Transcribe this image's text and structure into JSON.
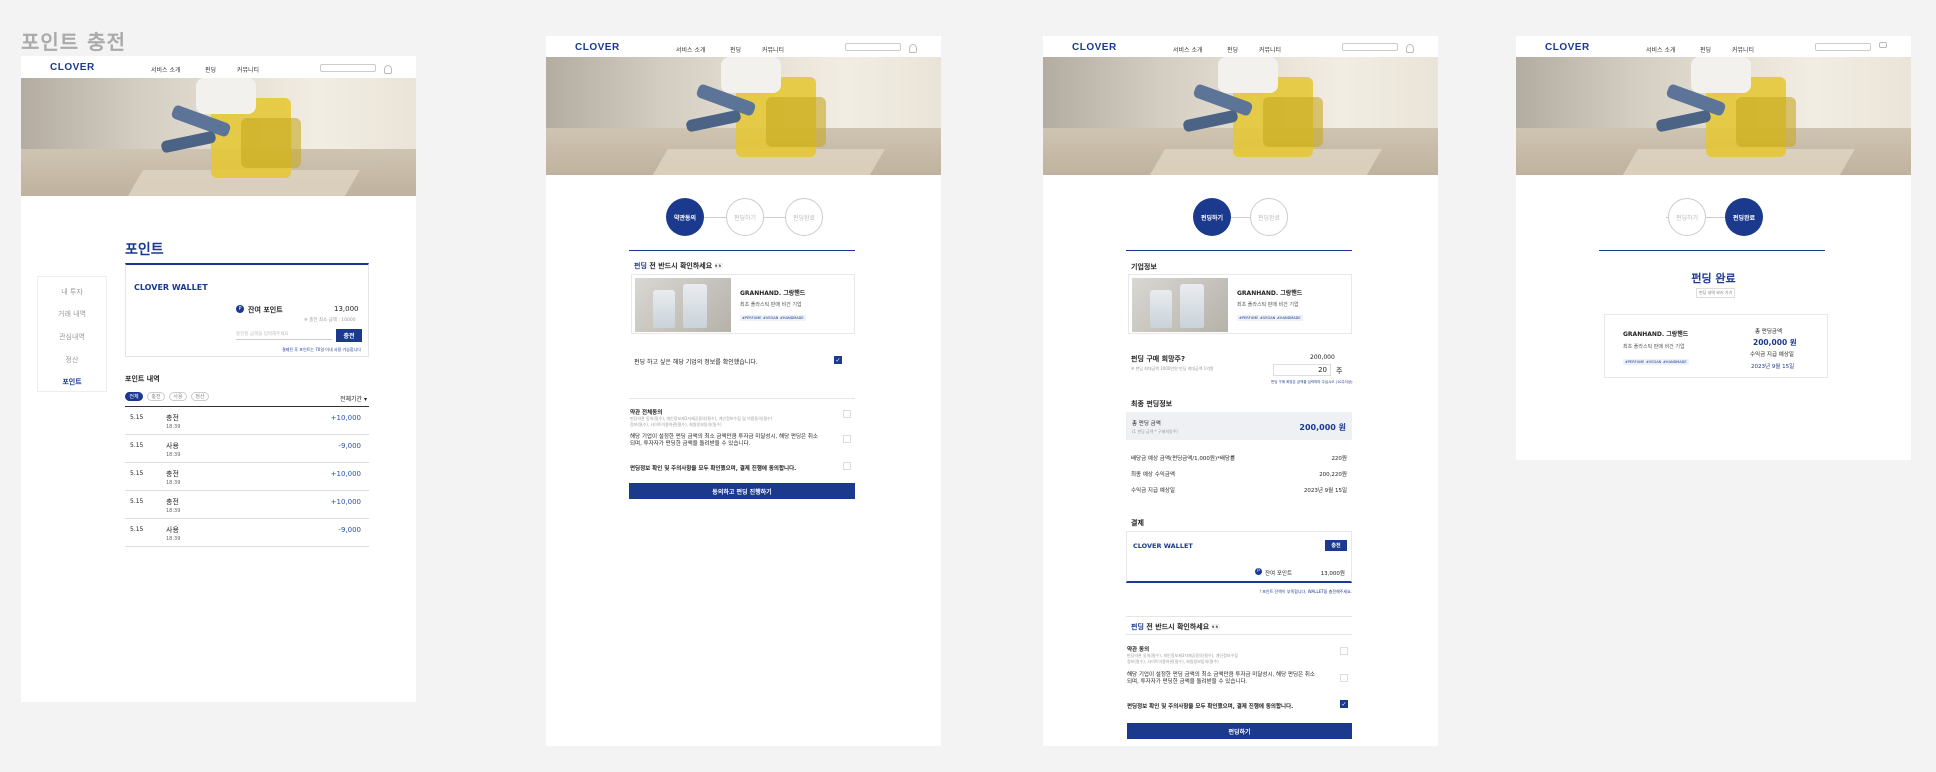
{
  "page_title": "포인트 충전",
  "nav": {
    "logo": "CLOVER",
    "links": [
      "서비스 소개",
      "펀딩",
      "커뮤니티"
    ]
  },
  "board1": {
    "sidebar": [
      "내 투자",
      "거래 내역",
      "관심내역",
      "정산",
      "포인트"
    ],
    "heading": "포인트",
    "wallet_title": "CLOVER WALLET",
    "balance_label": "잔여 포인트",
    "balance_value": "13,000",
    "min_charge_note": "※ 충전 최소 금액 : 10000",
    "charge_input_placeholder": "충전할 금액을 입력해주세요",
    "charge_button": "충전",
    "charge_note": "결제된 후 포인트는 70일 이내 사용 가능합니다",
    "history_title": "포인트 내역",
    "filters": [
      "전체",
      "충전",
      "사용",
      "정산"
    ],
    "period": "전체기간 ▾",
    "rows": [
      {
        "date": "5.15",
        "type": "충전",
        "time": "18:39",
        "amount": "+10,000"
      },
      {
        "date": "5.15",
        "type": "사용",
        "time": "18:39",
        "amount": "-9,000"
      },
      {
        "date": "5.15",
        "type": "충전",
        "time": "18:39",
        "amount": "+10,000"
      },
      {
        "date": "5.15",
        "type": "충전",
        "time": "18:39",
        "amount": "+10,000"
      },
      {
        "date": "5.15",
        "type": "사용",
        "time": "18:39",
        "amount": "-9,000"
      }
    ]
  },
  "board2": {
    "steps": [
      "약관동의",
      "펀딩하기",
      "펀딩완료"
    ],
    "notice_title_em": "펀딩",
    "notice_title": " 전 반드시 확인하세요 👀",
    "company_name": "GRANHAND. 그랑핸드",
    "company_desc": "최초 플라스틱 판매 비건 기업",
    "tags": [
      "#PERFUME",
      "#VEGAN",
      "#HANDMADE"
    ],
    "confirm_text": "펀딩 하고 싶은 해당 기업의 정보를 확인했습니다.",
    "terms_title": "약관 전체동의",
    "terms_desc_1": "펀딩약관 동의(필수), 개인정보제3자제공동의(필수), 개인정보수집 및 이용동의(필수)",
    "terms_desc_2": "정보(필수), 사이트이용약관(필수), 회원정보동의(필수)",
    "terms_item_2": "해당 기업이 설정한 펀딩 금액의 최소 금액만큼 투자금 미달성시, 해당 펀딩은 취소되며, 투자자가 펀딩한 금액을 돌려받을 수 있습니다.",
    "terms_item_3": "펀딩정보 확인 및 주의사항을 모두 확인했으며, 결제 진행에 동의합니다.",
    "submit": "동의하고 펀딩 진행하기"
  },
  "board3": {
    "steps": [
      "펀딩하기",
      "펀딩완료"
    ],
    "company_section": "기업정보",
    "company_name": "GRANHAND. 그랑핸드",
    "company_desc": "최초 플라스틱 판매 비건 기업",
    "tags": [
      "#PERFUME",
      "#VEGAN",
      "#HANDMADE"
    ],
    "qty_title": "펀딩 구매 희망주?",
    "qty_price": "200,000",
    "qty_note": "※ 펀딩 최대금액 1000만원 펀딩 최대금액 1억원",
    "qty_value": "20",
    "qty_unit": "주",
    "qty_sub": "펀딩 구매 희망은 금액을 입력하여 주십시오 (10주이상)",
    "final_title": "최종 펀딩정보",
    "total_label": "총 펀딩 금액",
    "total_note": "(1 펀딩 금액 * 구매희망주)",
    "total_value": "200,000 원",
    "lines": [
      {
        "label": "배당금 예상 금액(펀딩금액/1,000원)*배당률",
        "value": "220원"
      },
      {
        "label": "최종 예상 수익금액",
        "value": "200,220원"
      },
      {
        "label": "수익금 지급 예상일",
        "value": "2023년 9월 15일"
      }
    ],
    "pay_title": "결제",
    "wallet_title": "CLOVER WALLET",
    "charge_button": "충전",
    "balance_label": "잔여 포인트",
    "balance_value": "13,000원",
    "pay_note": "! 포인트 잔액이 부족합니다. WALLET을 충전해주세요.",
    "notice_title_em": "펀딩",
    "notice_title": " 전 반드시 확인하세요 👀",
    "terms_title": "약관 동의",
    "terms_desc_1": "펀딩약관 동의(필수), 개인정보제3자제공동의(필수), 개인정보수집",
    "terms_desc_2": "정보(필수), 사이트이용약관(필수), 회원정보동의(필수)",
    "terms_item_2": "해당 기업이 설정한 펀딩 금액의 최소 금액만큼 투자금 미달성시, 해당 펀딩은 취소되며, 투자자가 펀딩한 금액을 돌려받을 수 있습니다.",
    "terms_item_3": "펀딩정보 확인 및 주의사항을 모두 확인했으며, 결제 진행에 동의합니다.",
    "submit": "펀딩하기"
  },
  "board4": {
    "steps": [
      "펀딩하기",
      "펀딩완료"
    ],
    "done_title": "펀딩 완료",
    "done_link": "펀딩 내역 보러 가기",
    "company_name": "GRANHAND. 그랑핸드",
    "company_desc": "최초 플라스틱 판매 비건 기업",
    "tags": [
      "#PERFUME",
      "#VEGAN",
      "#HANDMADE"
    ],
    "total_label": "총 펀딩금액",
    "total_value": "200,000 원",
    "pay_date_label": "수익금 지급 예상일",
    "pay_date": "2023년 9월 15일"
  }
}
